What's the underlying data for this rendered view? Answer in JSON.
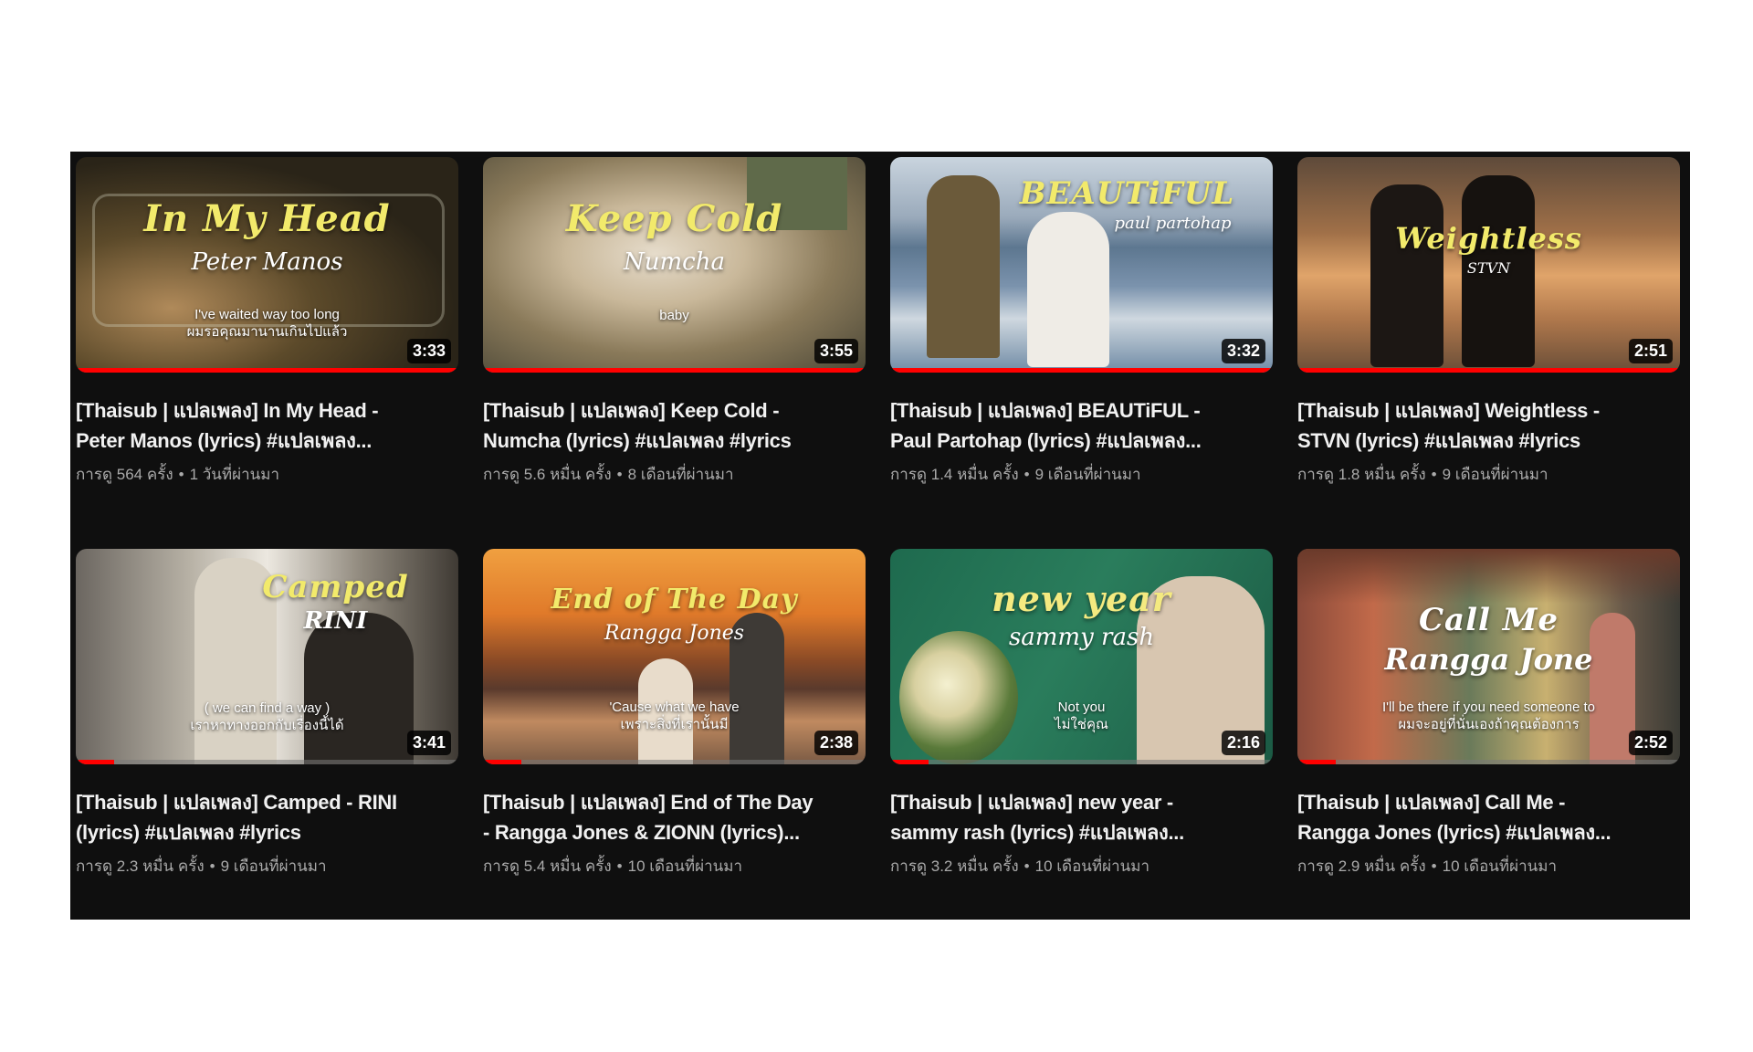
{
  "colors": {
    "background": "#0f0f0f",
    "title_text": "#f1f1f1",
    "meta_text": "#aaaaaa",
    "progress": "#ff0000",
    "thumb_title": "#f2ea6b"
  },
  "videos": [
    {
      "thumb_title": "In My Head",
      "thumb_artist": "Peter Manos",
      "thumb_lyric_1": "I've waited way too long",
      "thumb_lyric_2": "ผมรอคุณมานานเกินไปแล้ว",
      "duration": "3:33",
      "watched_fraction": 1.0,
      "title_line1": "[Thaisub | แปลเพลง] In My Head -",
      "title_line2": "Peter Manos (lyrics) #แปลเพลง...",
      "views": "การดู 564 ครั้ง",
      "age": "1 วันที่ผ่านมา"
    },
    {
      "thumb_title": "Keep Cold",
      "thumb_artist": "Numcha",
      "thumb_lyric_1": "baby",
      "thumb_lyric_2": "",
      "duration": "3:55",
      "watched_fraction": 1.0,
      "title_line1": "[Thaisub | แปลเพลง] Keep Cold -",
      "title_line2": "Numcha (lyrics) #แปลเพลง #lyrics",
      "views": "การดู 5.6 หมื่น ครั้ง",
      "age": "8 เดือนที่ผ่านมา"
    },
    {
      "thumb_title": "BEAUTiFUL",
      "thumb_artist": "paul partohap",
      "thumb_lyric_1": "",
      "thumb_lyric_2": "",
      "duration": "3:32",
      "watched_fraction": 1.0,
      "title_line1": "[Thaisub | แปลเพลง] BEAUTiFUL -",
      "title_line2": "Paul Partohap (lyrics) #แปลเพลง...",
      "views": "การดู 1.4 หมื่น ครั้ง",
      "age": "9 เดือนที่ผ่านมา"
    },
    {
      "thumb_title": "Weightless",
      "thumb_artist": "STVN",
      "thumb_lyric_1": "",
      "thumb_lyric_2": "",
      "duration": "2:51",
      "watched_fraction": 1.0,
      "title_line1": "[Thaisub | แปลเพลง] Weightless -",
      "title_line2": "STVN (lyrics) #แปลเพลง #lyrics",
      "views": "การดู 1.8 หมื่น ครั้ง",
      "age": "9 เดือนที่ผ่านมา"
    },
    {
      "thumb_title": "Camped",
      "thumb_artist": "RINI",
      "thumb_lyric_1": "( we can find a way )",
      "thumb_lyric_2": "เราหาทางออกกับเรื่องนี้ได้",
      "duration": "3:41",
      "watched_fraction": 0.1,
      "title_line1": "[Thaisub | แปลเพลง] Camped - RINI",
      "title_line2": "(lyrics) #แปลเพลง #lyrics",
      "views": "การดู 2.3 หมื่น ครั้ง",
      "age": "9 เดือนที่ผ่านมา"
    },
    {
      "thumb_title": "End of The Day",
      "thumb_artist": "Rangga Jones",
      "thumb_lyric_1": "'Cause what we have",
      "thumb_lyric_2": "เพราะสิ่งที่เรานั้นมี",
      "duration": "2:38",
      "watched_fraction": 0.1,
      "title_line1": "[Thaisub | แปลเพลง] End of The Day",
      "title_line2": "- Rangga Jones & ZIONN (lyrics)...",
      "views": "การดู 5.4 หมื่น ครั้ง",
      "age": "10 เดือนที่ผ่านมา"
    },
    {
      "thumb_title": "new year",
      "thumb_artist": "sammy rash",
      "thumb_lyric_1": "Not you",
      "thumb_lyric_2": "ไม่ใช่คุณ",
      "duration": "2:16",
      "watched_fraction": 0.1,
      "title_line1": "[Thaisub | แปลเพลง] new year -",
      "title_line2": "sammy rash (lyrics) #แปลเพลง...",
      "views": "การดู 3.2 หมื่น ครั้ง",
      "age": "10 เดือนที่ผ่านมา"
    },
    {
      "thumb_title": "Call Me",
      "thumb_artist": "Rangga Jone",
      "thumb_lyric_1": "I'll be there if you need someone to",
      "thumb_lyric_2": "ผมจะอยู่ที่นั่นเองถ้าคุณต้องการ",
      "duration": "2:52",
      "watched_fraction": 0.1,
      "title_line1": "[Thaisub | แปลเพลง] Call Me -",
      "title_line2": "Rangga Jones (lyrics) #แปลเพลง...",
      "views": "การดู 2.9 หมื่น ครั้ง",
      "age": "10 เดือนที่ผ่านมา"
    }
  ]
}
